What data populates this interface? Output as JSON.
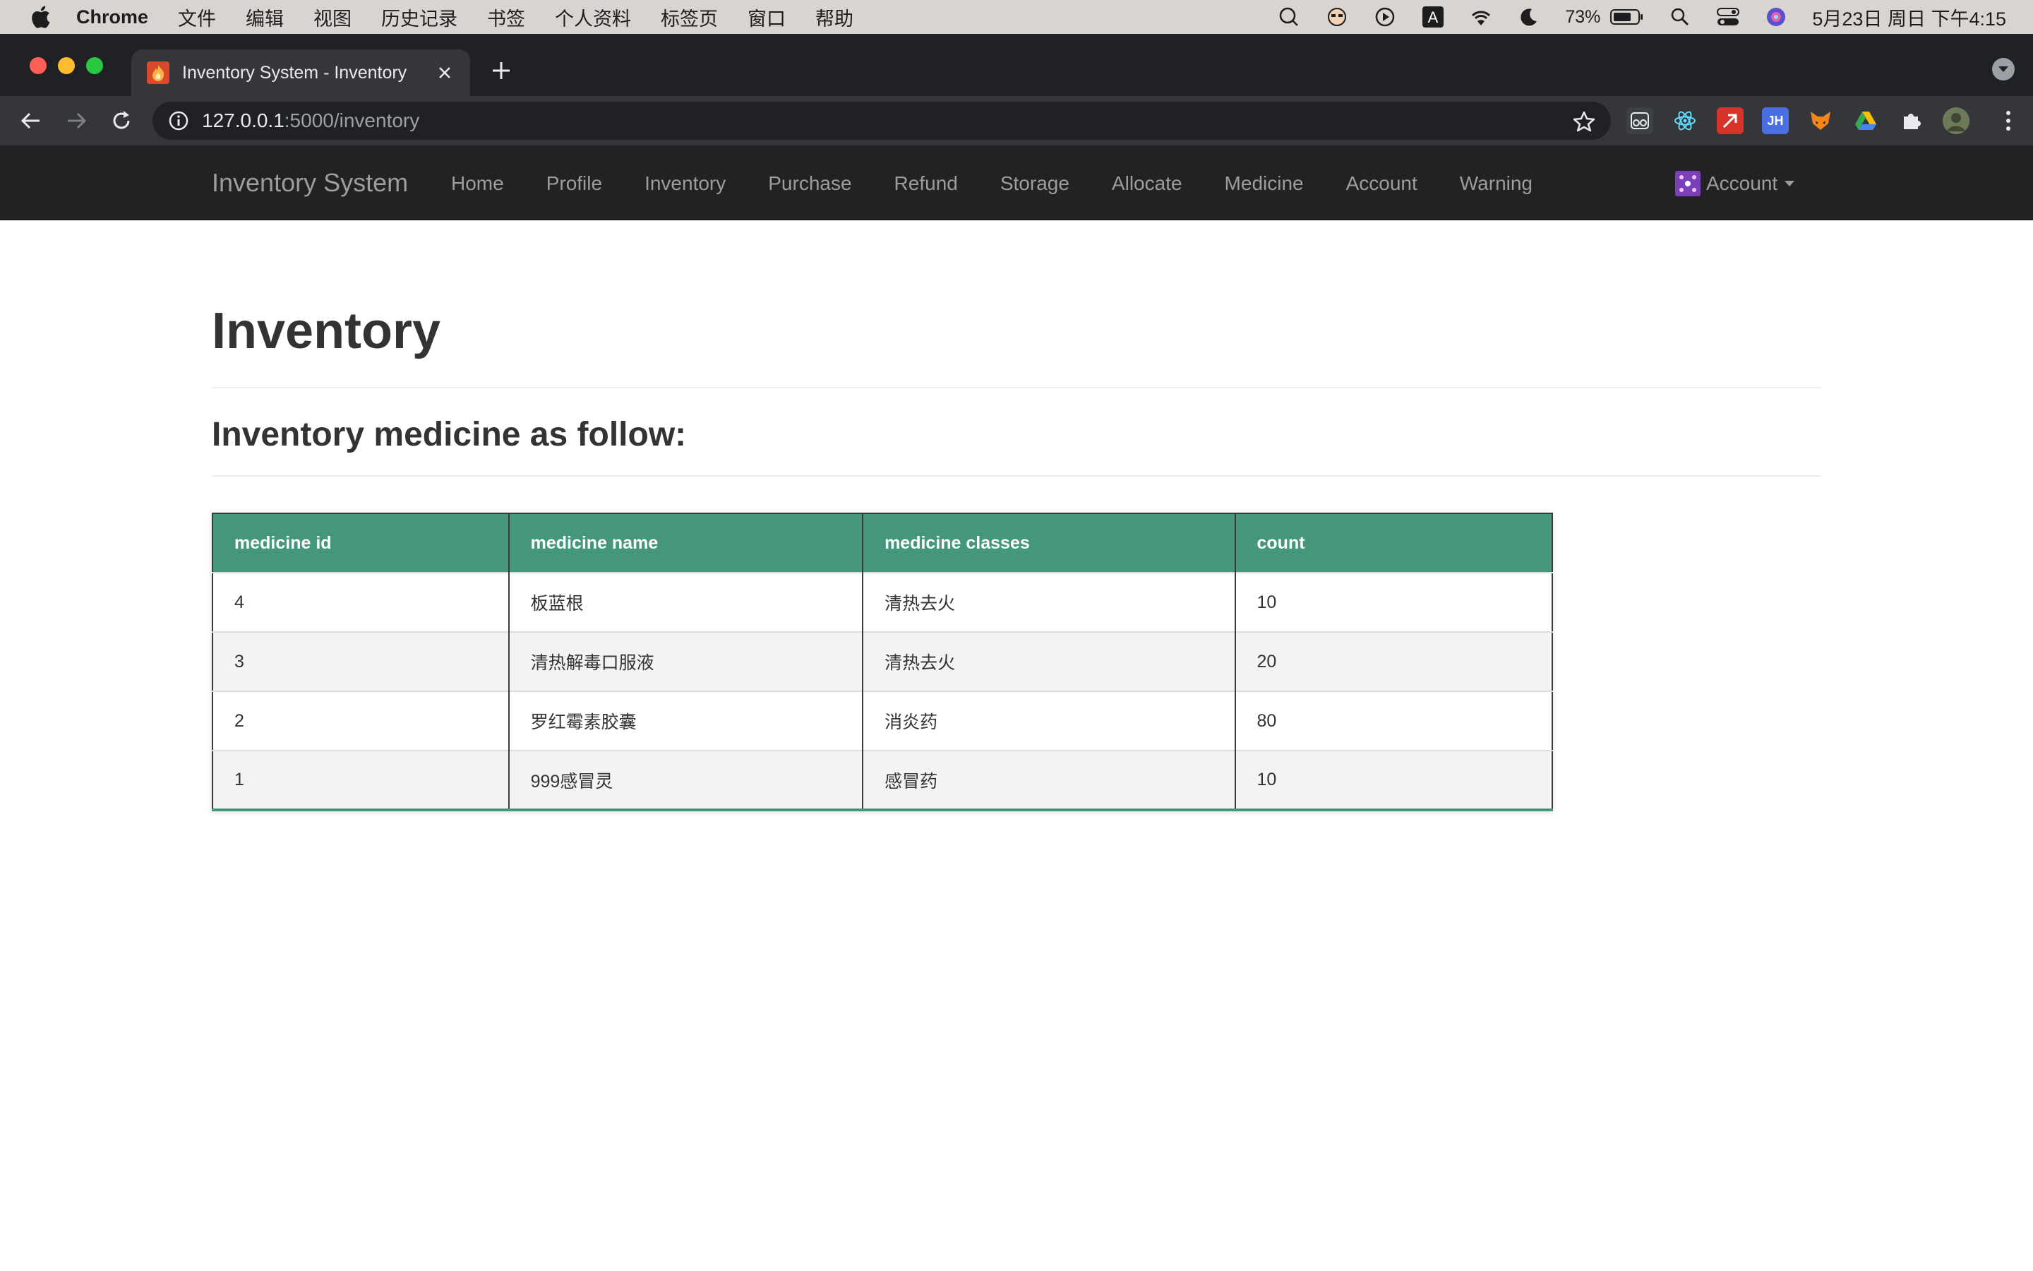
{
  "os_menubar": {
    "app_name": "Chrome",
    "items": [
      "文件",
      "编辑",
      "视图",
      "历史记录",
      "书签",
      "个人资料",
      "标签页",
      "窗口",
      "帮助"
    ],
    "battery": "73%",
    "clock": "5月23日 周日 下午4:15"
  },
  "browser": {
    "tab_title": "Inventory System - Inventory",
    "url_host": "127.0.0.1",
    "url_rest": ":5000/inventory",
    "extension_jh_label": "JH"
  },
  "navbar": {
    "brand": "Inventory System",
    "links": [
      "Home",
      "Profile",
      "Inventory",
      "Purchase",
      "Refund",
      "Storage",
      "Allocate",
      "Medicine",
      "Account",
      "Warning"
    ],
    "account_label": "Account"
  },
  "page": {
    "title": "Inventory",
    "subtitle": "Inventory medicine as follow:"
  },
  "table": {
    "headers": [
      "medicine id",
      "medicine name",
      "medicine classes",
      "count"
    ],
    "rows": [
      [
        "4",
        "板蓝根",
        "清热去火",
        "10"
      ],
      [
        "3",
        "清热解毒口服液",
        "清热去火",
        "20"
      ],
      [
        "2",
        "罗红霉素胶囊",
        "消炎药",
        "80"
      ],
      [
        "1",
        "999感冒灵",
        "感冒药",
        "10"
      ]
    ]
  },
  "colors": {
    "navbar_bg": "#222222",
    "table_header_bg": "#44977c",
    "chrome_dark": "#202124"
  }
}
